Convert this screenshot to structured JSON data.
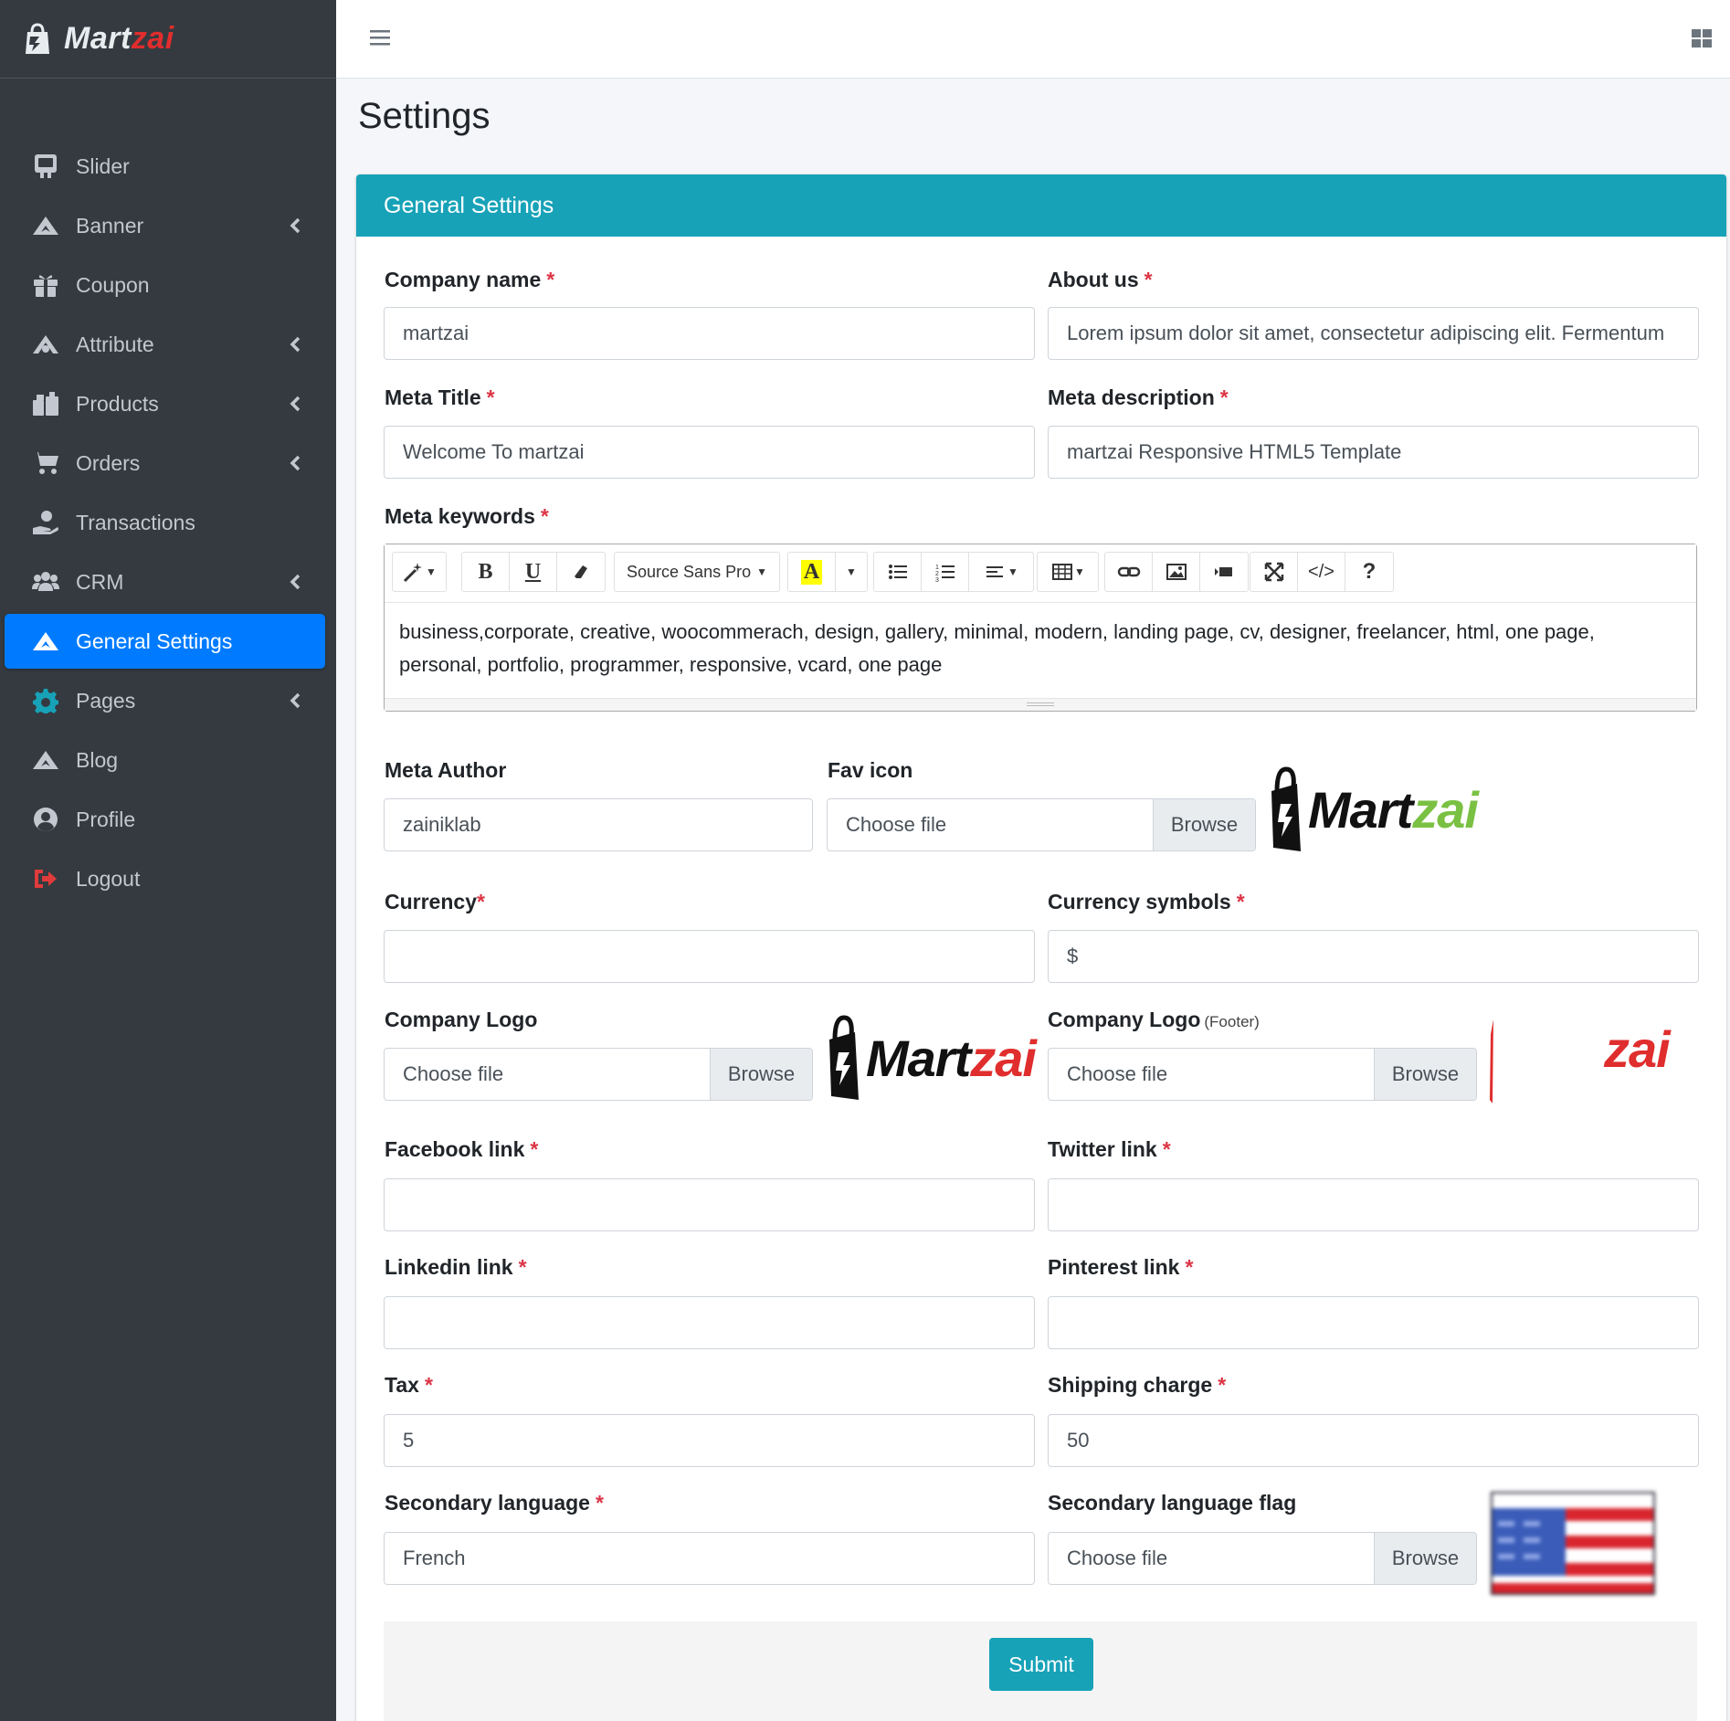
{
  "brand": {
    "name_part1": "Mart",
    "name_part2": "zai"
  },
  "sidebar": {
    "items": [
      {
        "label": "Slider",
        "icon": "slider-icon",
        "has_chevron": false
      },
      {
        "label": "Banner",
        "icon": "banner-icon",
        "has_chevron": true
      },
      {
        "label": "Coupon",
        "icon": "gift-icon",
        "has_chevron": false
      },
      {
        "label": "Attribute",
        "icon": "attribute-icon",
        "has_chevron": true
      },
      {
        "label": "Products",
        "icon": "products-icon",
        "has_chevron": true
      },
      {
        "label": "Orders",
        "icon": "cart-icon",
        "has_chevron": true
      },
      {
        "label": "Transactions",
        "icon": "hand-coin-icon",
        "has_chevron": false
      },
      {
        "label": "CRM",
        "icon": "users-icon",
        "has_chevron": true
      },
      {
        "label": "General Settings",
        "icon": "settings-icon",
        "has_chevron": false,
        "active": true
      },
      {
        "label": "Pages",
        "icon": "gear-icon",
        "has_chevron": true
      },
      {
        "label": "Blog",
        "icon": "blog-icon",
        "has_chevron": false
      },
      {
        "label": "Profile",
        "icon": "user-circle-icon",
        "has_chevron": false
      },
      {
        "label": "Logout",
        "icon": "logout-icon",
        "has_chevron": false
      }
    ]
  },
  "page": {
    "title": "Settings"
  },
  "card": {
    "title": "General Settings"
  },
  "form": {
    "company_name": {
      "label": "Company name",
      "value": "martzai"
    },
    "about_us": {
      "label": "About us",
      "value": "Lorem ipsum dolor sit amet, consectetur adipiscing elit. Fermentum"
    },
    "meta_title": {
      "label": "Meta Title",
      "value": "Welcome To martzai"
    },
    "meta_description": {
      "label": "Meta description",
      "value": "martzai Responsive  HTML5 Template"
    },
    "meta_keywords": {
      "label": "Meta keywords",
      "font_select": "Source Sans Pro",
      "value": "business,corporate, creative, woocommerach, design, gallery, minimal, modern, landing page, cv, designer, freelancer, html, one page, personal, portfolio, programmer, responsive, vcard, one page"
    },
    "meta_author": {
      "label": "Meta Author",
      "value": "zainiklab"
    },
    "fav_icon": {
      "label": "Fav icon",
      "placeholder": "Choose file",
      "button": "Browse"
    },
    "currency": {
      "label": "Currency",
      "value": ""
    },
    "currency_symbols": {
      "label": "Currency symbols",
      "value": "$"
    },
    "company_logo": {
      "label": "Company Logo",
      "placeholder": "Choose file",
      "button": "Browse"
    },
    "company_logo_footer": {
      "label": "Company Logo",
      "sublabel": "(Footer)",
      "placeholder": "Choose file",
      "button": "Browse"
    },
    "facebook": {
      "label": "Facebook link",
      "value": ""
    },
    "twitter": {
      "label": "Twitter link",
      "value": ""
    },
    "linkedin": {
      "label": "Linkedin link",
      "value": ""
    },
    "pinterest": {
      "label": "Pinterest link",
      "value": ""
    },
    "tax": {
      "label": "Tax",
      "value": "5"
    },
    "shipping_charge": {
      "label": "Shipping charge",
      "value": "50"
    },
    "secondary_language": {
      "label": "Secondary language",
      "value": "French"
    },
    "secondary_language_flag": {
      "label": "Secondary language flag",
      "placeholder": "Choose file",
      "button": "Browse"
    },
    "submit": "Submit"
  },
  "logo_previews": {
    "fav_icon": {
      "part1": "Mart",
      "part2": "zai"
    },
    "company_logo": {
      "part1": "Mart",
      "part2": "zai"
    },
    "footer_logo": {
      "part2": "zai"
    }
  },
  "colors": {
    "sidebar_bg": "#343a40",
    "active_nav": "#007bff",
    "card_header": "#17a2b8",
    "required": "#dc3545",
    "brand_red": "#e02d2d",
    "fav_green": "#7ac143"
  }
}
